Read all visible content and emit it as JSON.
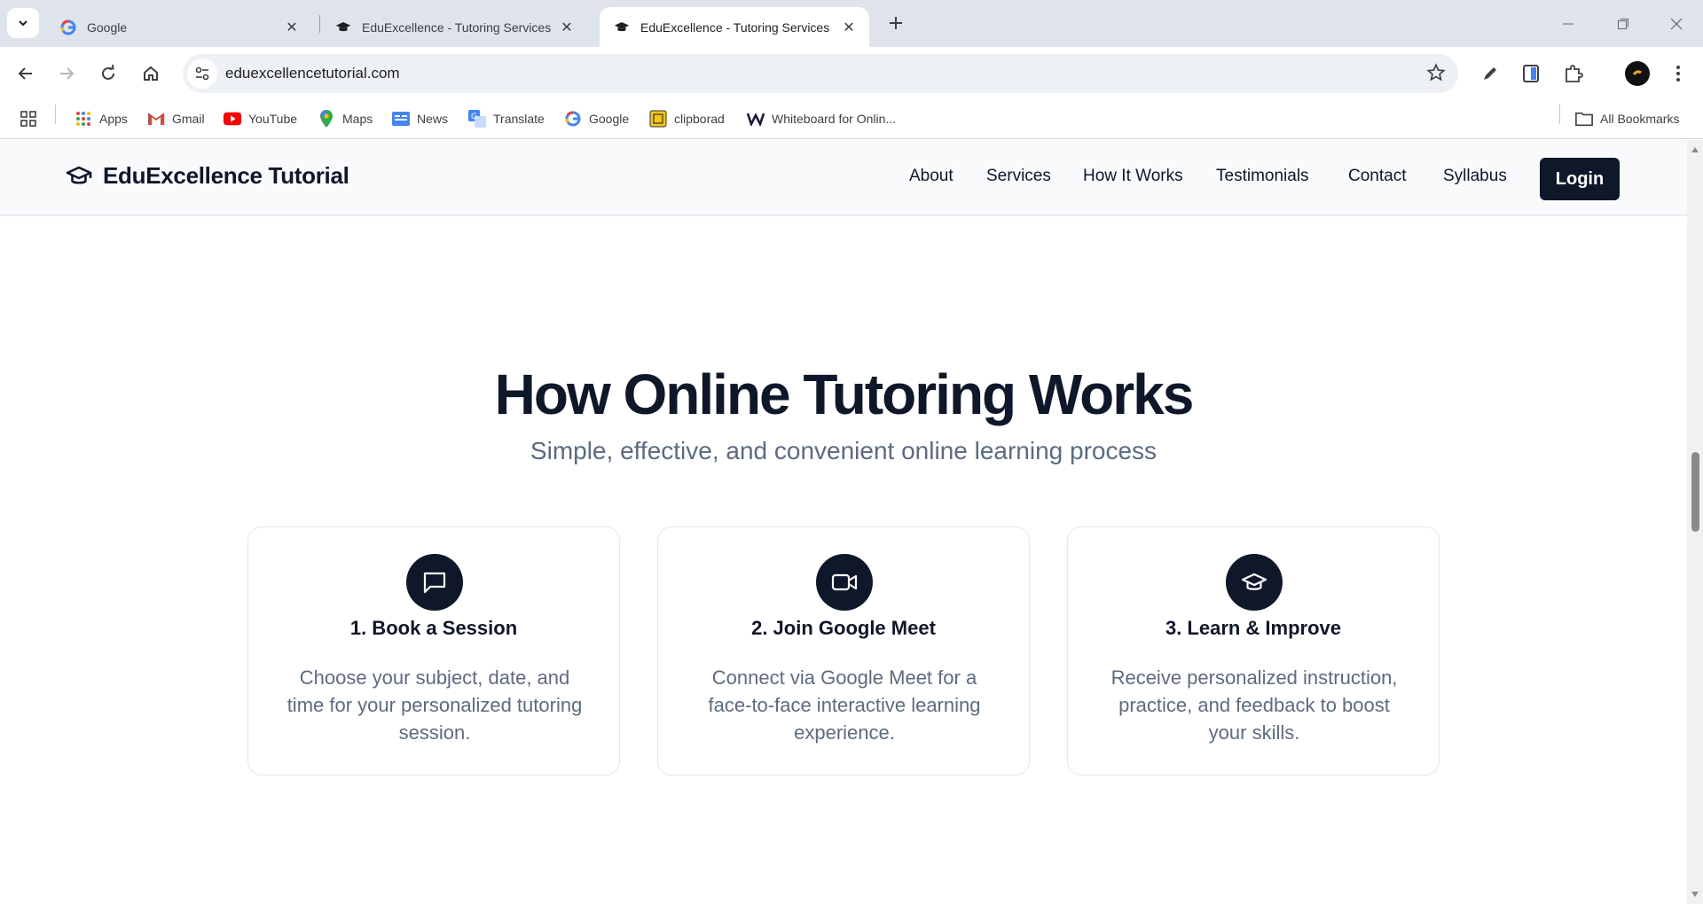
{
  "browser": {
    "tabs": [
      {
        "title": "Google",
        "active": false
      },
      {
        "title": "EduExcellence - Tutoring Services",
        "active": false
      },
      {
        "title": "EduExcellence - Tutoring Services",
        "active": true
      }
    ],
    "url": "eduexcellencetutorial.com",
    "bookmarks": [
      {
        "label": "Apps",
        "icon": "apps-grid-icon"
      },
      {
        "label": "Gmail",
        "icon": "gmail-icon"
      },
      {
        "label": "YouTube",
        "icon": "youtube-icon"
      },
      {
        "label": "Maps",
        "icon": "maps-pin-icon"
      },
      {
        "label": "News",
        "icon": "news-icon"
      },
      {
        "label": "Translate",
        "icon": "translate-icon"
      },
      {
        "label": "Google",
        "icon": "google-icon"
      },
      {
        "label": "clipborad",
        "icon": "clipboard-icon"
      },
      {
        "label": "Whiteboard for Onlin...",
        "icon": "whiteboard-w-icon"
      }
    ],
    "all_bookmarks_label": "All Bookmarks"
  },
  "site": {
    "brand": "EduExcellence Tutorial",
    "nav": [
      "About",
      "Services",
      "How It Works",
      "Testimonials",
      "Contact",
      "Syllabus"
    ],
    "login_label": "Login"
  },
  "section": {
    "title": "How Online Tutoring Works",
    "subtitle": "Simple, effective, and convenient online learning process",
    "steps": [
      {
        "title": "1. Book a Session",
        "description": "Choose your subject, date, and time for your personalized tutoring session.",
        "icon": "chat-bubble-icon"
      },
      {
        "title": "2. Join Google Meet",
        "description": "Connect via Google Meet for a face-to-face interactive learning experience.",
        "icon": "video-camera-icon"
      },
      {
        "title": "3. Learn & Improve",
        "description": "Receive personalized instruction, practice, and feedback to boost your skills.",
        "icon": "graduation-cap-icon"
      }
    ]
  },
  "colors": {
    "brand_dark": "#0f172a",
    "muted_text": "#5b6b82",
    "tabstrip": "#dfe3eb"
  }
}
